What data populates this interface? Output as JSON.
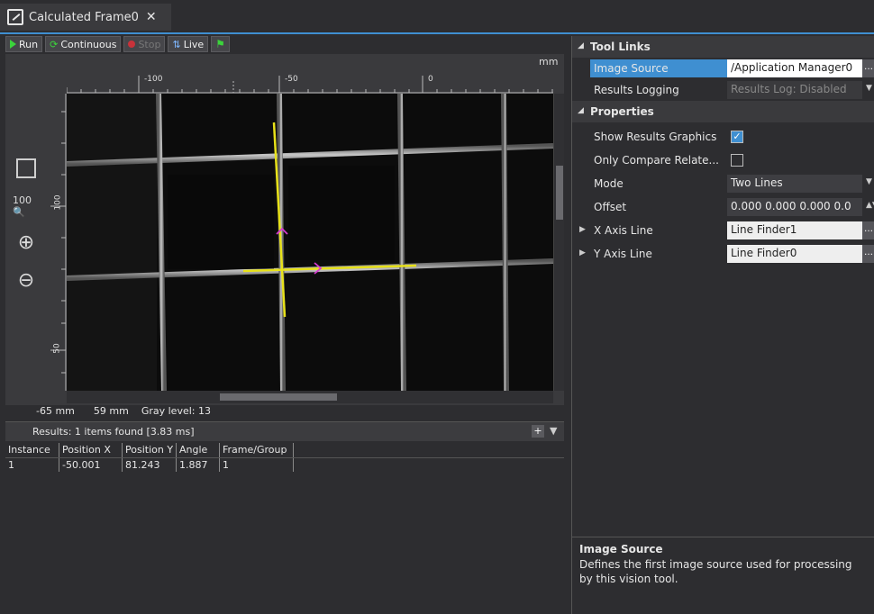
{
  "tab": {
    "title": "Calculated Frame0",
    "close": "✕"
  },
  "toolbar": {
    "run": "Run",
    "continuous": "Continuous",
    "stop": "Stop",
    "live": "Live"
  },
  "viewer": {
    "unit": "mm",
    "h_ticks": [
      "-100",
      "-50",
      "0"
    ],
    "v_ticks": [
      "100",
      "50"
    ],
    "status": {
      "x": "-65 mm",
      "y": "59 mm",
      "gray": "Gray level: 13"
    }
  },
  "results": {
    "summary": "Results: 1 items found [3.83 ms]",
    "plus": "+",
    "columns": [
      "Instance",
      "Position X",
      "Position Y",
      "Angle",
      "Frame/Group"
    ],
    "rows": [
      [
        "1",
        "-50.001",
        "81.243",
        "1.887",
        "1"
      ]
    ]
  },
  "panel": {
    "tool_links": {
      "header": "Tool Links",
      "image_source_label": "Image Source",
      "image_source_value": "/Application Manager0",
      "results_logging_label": "Results Logging",
      "results_logging_value": "Results Log: Disabled"
    },
    "properties": {
      "header": "Properties",
      "show_results_graphics_label": "Show Results Graphics",
      "show_results_graphics": true,
      "only_compare_label": "Only Compare Relate...",
      "only_compare": false,
      "mode_label": "Mode",
      "mode_value": "Two Lines",
      "offset_label": "Offset",
      "offset_value": "0.000 0.000 0.000 0.0",
      "x_axis_label": "X Axis Line",
      "x_axis_value": "Line Finder1",
      "y_axis_label": "Y Axis Line",
      "y_axis_value": "Line Finder0"
    },
    "description": {
      "title": "Image Source",
      "text": "Defines the first image source used for processing by this vision tool."
    }
  },
  "colors": {
    "accent": "#3f8fd1",
    "overlay_line": "#e8e21a",
    "overlay_arrow": "#d63ad0"
  }
}
